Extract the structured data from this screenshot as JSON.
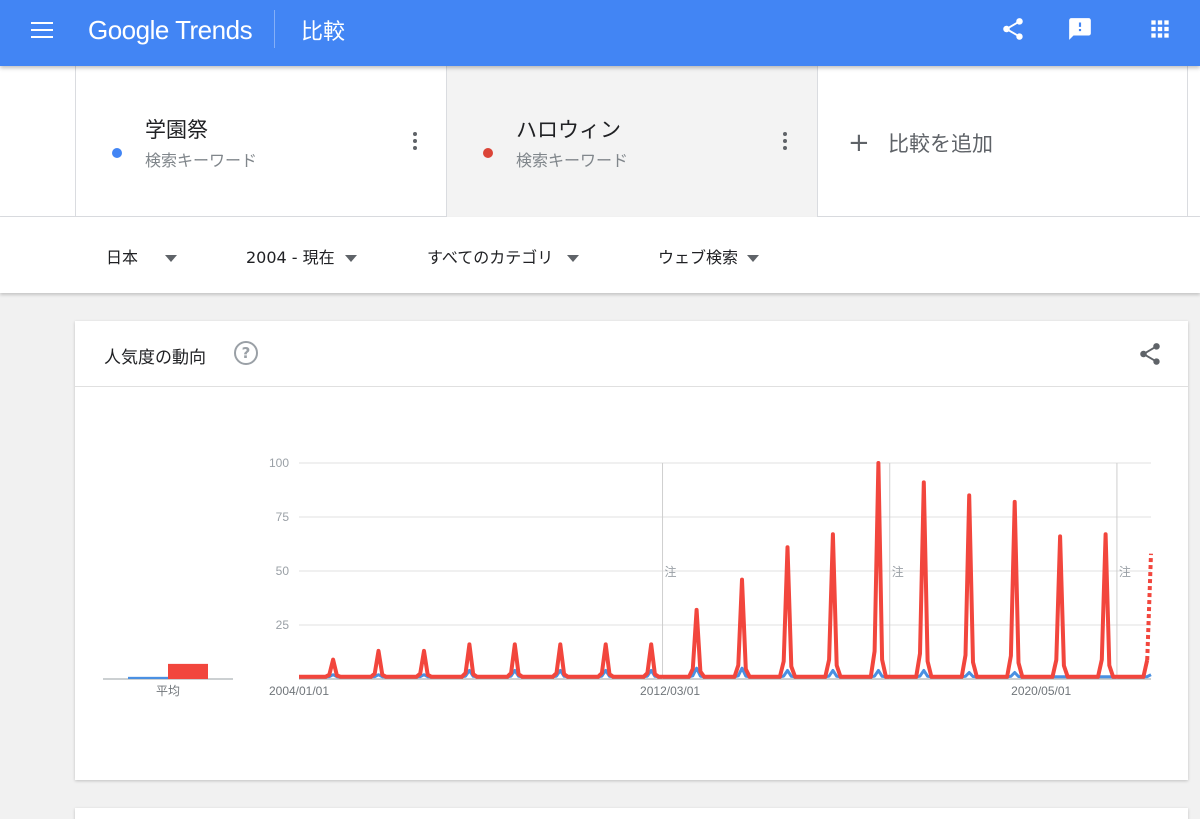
{
  "header": {
    "logo_google": "Google",
    "logo_trends": "Trends",
    "page_title": "比較",
    "icons": [
      "menu-icon",
      "share-icon",
      "feedback-icon",
      "apps-icon"
    ],
    "bar_color": "#4285f4"
  },
  "keywords": [
    {
      "term": "学園祭",
      "type": "検索キーワード",
      "color": "#4285f4"
    },
    {
      "term": "ハロウィン",
      "type": "検索キーワード",
      "color": "#db4437"
    }
  ],
  "add_compare_label": "比較を追加",
  "filters": {
    "region": "日本",
    "period": "2004 - 現在",
    "category": "すべてのカテゴリ",
    "search_type": "ウェブ検索"
  },
  "interest_card": {
    "title": "人気度の動向",
    "help_label": "?",
    "average_label": "平均",
    "note_marker": "注"
  },
  "chart_data": {
    "type": "line",
    "x_tick_labels": [
      "2004/01/01",
      "2012/03/01",
      "2020/05/01"
    ],
    "y_ticks": [
      25,
      50,
      75,
      100
    ],
    "ylim": [
      0,
      100
    ],
    "grid": true,
    "series_colors": [
      "#4a90e2",
      "#f2463d"
    ],
    "x_range": [
      "2004-01",
      "2022-10"
    ],
    "annotation_dates": [
      "2012-01",
      "2017-01",
      "2022-01"
    ],
    "averages": {
      "学園祭": 1,
      "ハロウィン": 7
    },
    "series": [
      {
        "name": "学園祭",
        "peaks": [
          {
            "date": "2004-10",
            "value": 2
          },
          {
            "date": "2005-10",
            "value": 2
          },
          {
            "date": "2006-10",
            "value": 2
          },
          {
            "date": "2007-10",
            "value": 4
          },
          {
            "date": "2008-10",
            "value": 4
          },
          {
            "date": "2009-10",
            "value": 4
          },
          {
            "date": "2010-10",
            "value": 4
          },
          {
            "date": "2011-10",
            "value": 4
          },
          {
            "date": "2012-10",
            "value": 5
          },
          {
            "date": "2013-10",
            "value": 5
          },
          {
            "date": "2014-10",
            "value": 4
          },
          {
            "date": "2015-10",
            "value": 4
          },
          {
            "date": "2016-10",
            "value": 4
          },
          {
            "date": "2017-10",
            "value": 4
          },
          {
            "date": "2018-10",
            "value": 3
          },
          {
            "date": "2019-10",
            "value": 3
          },
          {
            "date": "2020-10",
            "value": 1
          },
          {
            "date": "2021-10",
            "value": 1
          },
          {
            "date": "2022-10",
            "value": 2
          }
        ],
        "baseline": 1
      },
      {
        "name": "ハロウィン",
        "peaks": [
          {
            "date": "2004-10",
            "value": 9
          },
          {
            "date": "2005-10",
            "value": 13
          },
          {
            "date": "2006-10",
            "value": 13
          },
          {
            "date": "2007-10",
            "value": 16
          },
          {
            "date": "2008-10",
            "value": 16
          },
          {
            "date": "2009-10",
            "value": 16
          },
          {
            "date": "2010-10",
            "value": 16
          },
          {
            "date": "2011-10",
            "value": 16
          },
          {
            "date": "2012-10",
            "value": 32
          },
          {
            "date": "2013-10",
            "value": 46
          },
          {
            "date": "2014-10",
            "value": 61
          },
          {
            "date": "2015-10",
            "value": 67
          },
          {
            "date": "2016-10",
            "value": 100
          },
          {
            "date": "2017-10",
            "value": 91
          },
          {
            "date": "2018-10",
            "value": 85
          },
          {
            "date": "2019-10",
            "value": 82
          },
          {
            "date": "2020-10",
            "value": 66
          },
          {
            "date": "2021-10",
            "value": 67
          },
          {
            "date": "2022-10",
            "value": 66
          }
        ],
        "baseline": 1,
        "partial_last_value": 58
      }
    ]
  }
}
